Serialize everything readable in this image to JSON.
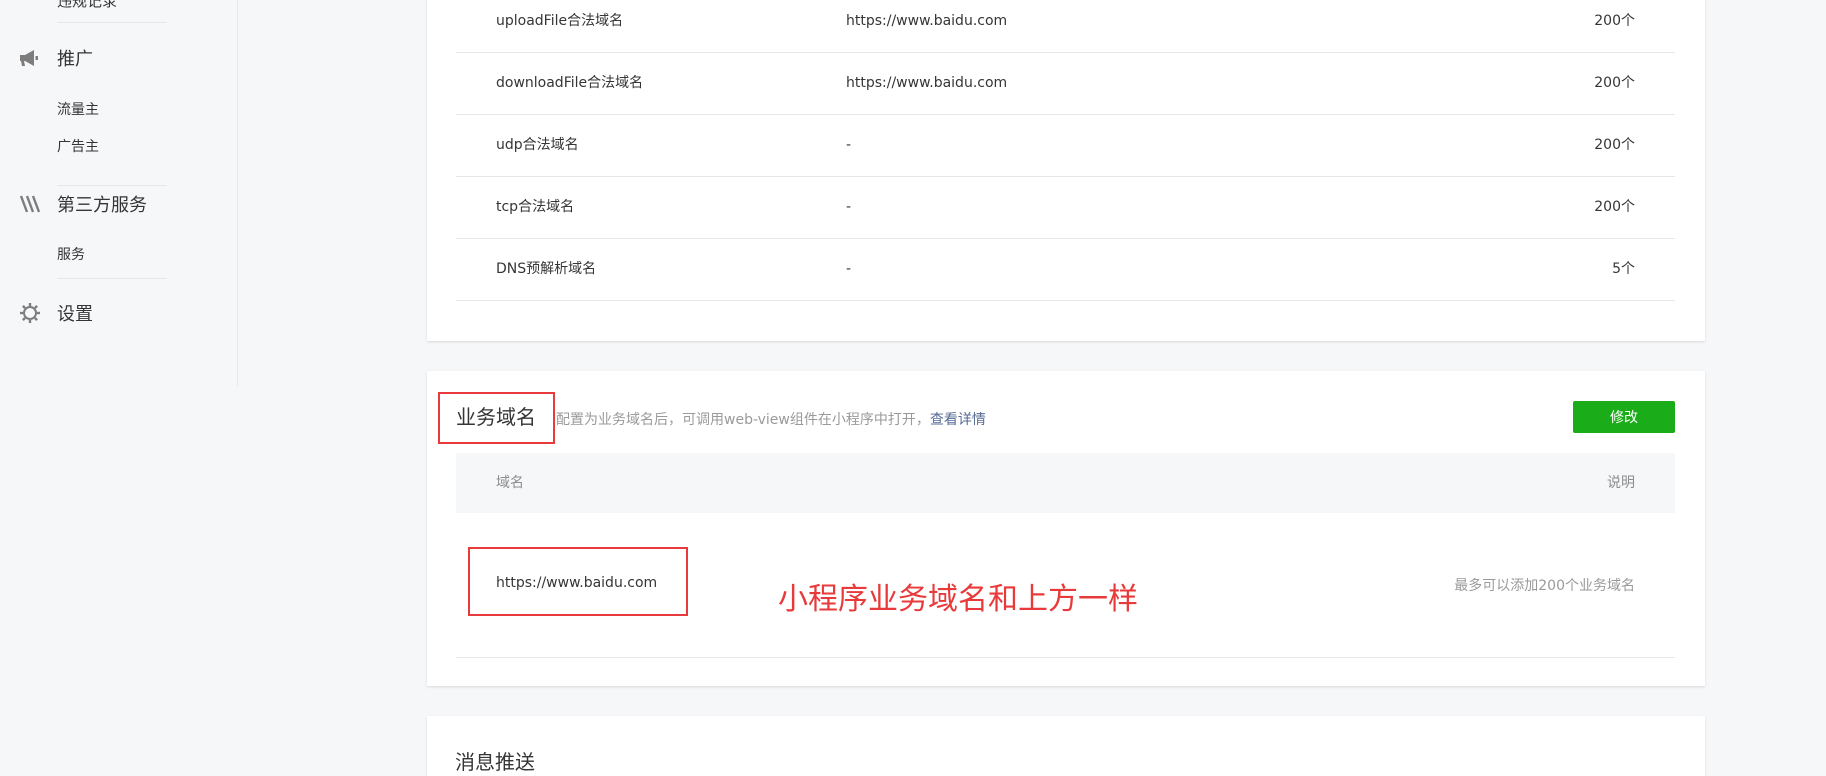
{
  "sidebar": {
    "cut_item": "违规记录",
    "groups": [
      {
        "label": "推广",
        "icon": "megaphone-icon",
        "items": [
          "流量主",
          "广告主"
        ]
      },
      {
        "label": "第三方服务",
        "icon": "third-party-icon",
        "items": [
          "服务"
        ]
      },
      {
        "label": "设置",
        "icon": "gear-icon",
        "items": []
      }
    ]
  },
  "server_domains": {
    "rows": [
      {
        "name": "uploadFile合法域名",
        "value": "https://www.baidu.com",
        "limit": "200个"
      },
      {
        "name": "downloadFile合法域名",
        "value": "https://www.baidu.com",
        "limit": "200个"
      },
      {
        "name": "udp合法域名",
        "value": "-",
        "limit": "200个"
      },
      {
        "name": "tcp合法域名",
        "value": "-",
        "limit": "200个"
      },
      {
        "name": "DNS预解析域名",
        "value": "-",
        "limit": "5个"
      }
    ]
  },
  "business_domain": {
    "title": "业务域名",
    "desc": "配置为业务域名后，可调用web-view组件在小程序中打开，",
    "desc_link": "查看详情",
    "edit_label": "修改",
    "col_domain": "域名",
    "col_note": "说明",
    "domain_value": "https://www.baidu.com",
    "note_value": "最多可以添加200个业务域名",
    "annotation": "小程序业务域名和上方一样"
  },
  "message_push": {
    "title": "消息推送"
  },
  "colors": {
    "primary_button": "#1aad19",
    "link": "#576b95",
    "annotation_red": "#e83a3a"
  }
}
